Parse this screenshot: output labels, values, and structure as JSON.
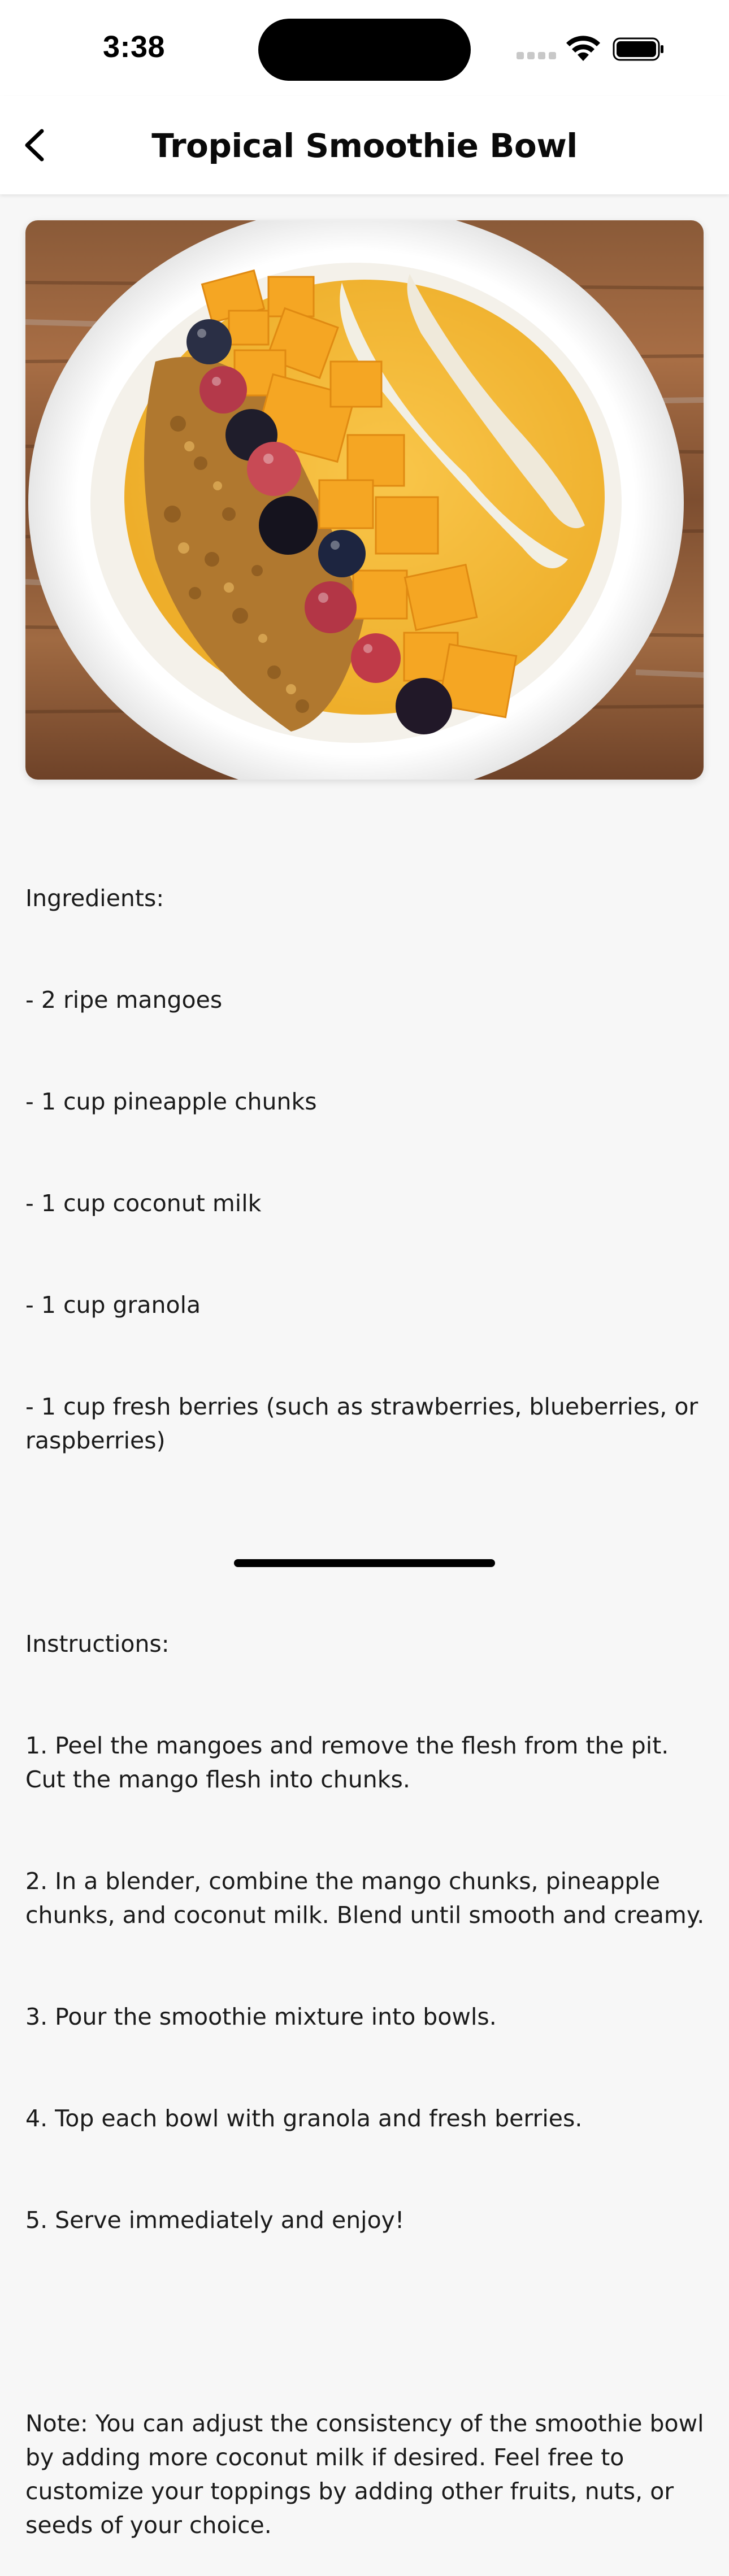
{
  "status_bar": {
    "time": "3:38"
  },
  "nav": {
    "title": "Tropical Smoothie Bowl",
    "back_icon": "chevron-left-icon"
  },
  "hero_image": {
    "subject": "smoothie-bowl-photo"
  },
  "recipe": {
    "ingredients_heading": "Ingredients:",
    "ingredients": [
      "- 2 ripe mangoes",
      "- 1 cup pineapple chunks",
      "- 1 cup coconut milk",
      "- 1 cup granola",
      "- 1 cup fresh berries (such as strawberries, blueberries, or raspberries)"
    ],
    "instructions_heading": "Instructions:",
    "instructions": [
      "1. Peel the mangoes and remove the flesh from the pit. Cut the mango flesh into chunks.",
      "2. In a blender, combine the mango chunks, pineapple chunks, and coconut milk. Blend until smooth and creamy.",
      "3. Pour the smoothie mixture into bowls.",
      "4. Top each bowl with granola and fresh berries.",
      "5. Serve immediately and enjoy!"
    ],
    "note": "Note: You can adjust the consistency of the smoothie bowl by adding more coconut milk if desired. Feel free to customize your toppings by adding other fruits, nuts, or seeds of your choice."
  },
  "colors": {
    "background": "#f7f7f7",
    "bar_background": "#ffffff",
    "text": "#1a1a1a"
  }
}
